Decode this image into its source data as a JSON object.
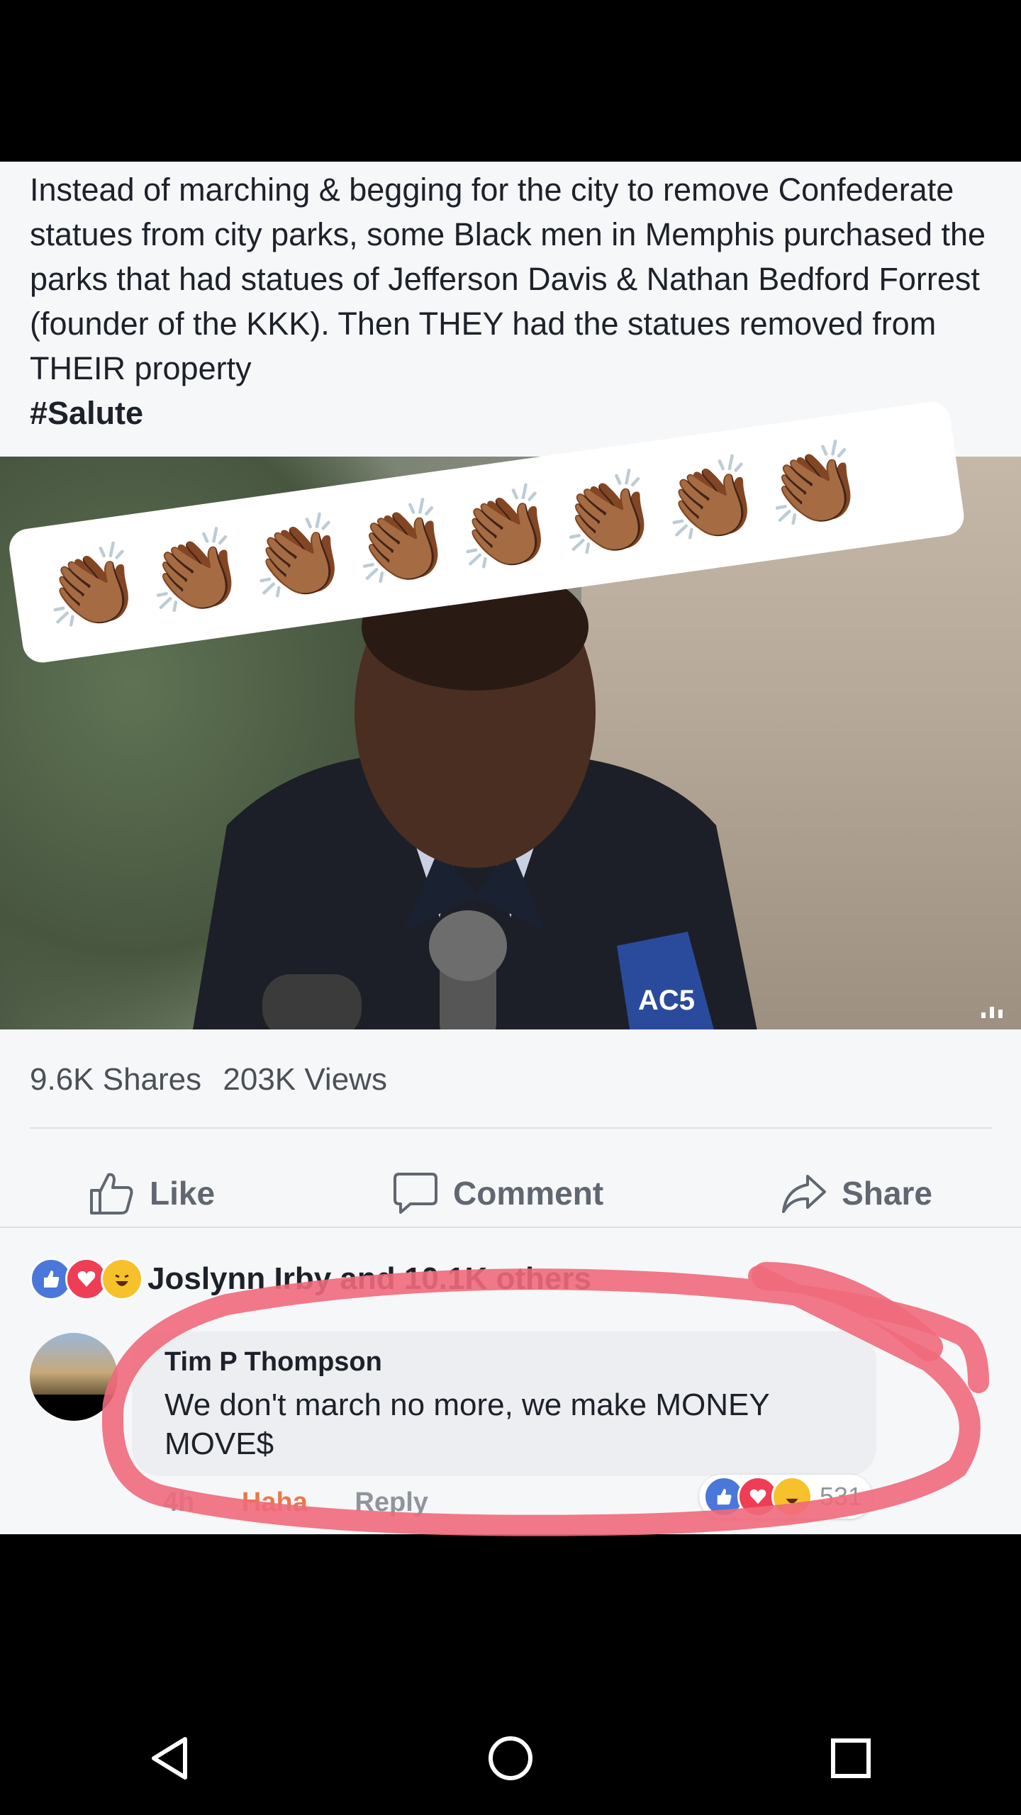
{
  "post": {
    "text": "Instead of marching & begging for the city to remove Confederate statues from city parks, some Black men in Memphis purchased the parks that had statues of Jefferson Davis & Nathan Bedford Forrest (founder of the KKK). Then THEY had the statues removed from THEIR property",
    "hashtag": "#Salute",
    "video": {
      "overlay_emoji": "👏🏾👏🏾👏🏾👏🏾👏🏾👏🏾👏🏾👏🏾",
      "mic_logo_text": "AC5"
    }
  },
  "stats": {
    "shares": "9.6K Shares",
    "views": "203K Views"
  },
  "actions": {
    "like": "Like",
    "comment": "Comment",
    "share": "Share"
  },
  "reactions": {
    "summary": "Joslynn Irby and 10.1K others"
  },
  "comment": {
    "author": "Tim P Thompson",
    "text": "We don't march no more, we make MONEY MOVE$",
    "time": "4h",
    "haha": "Haha",
    "reply": "Reply",
    "reaction_count": "531"
  },
  "colors": {
    "like_blue": "#4a77d9",
    "love_red": "#ee3d54",
    "haha_yellow": "#f7c12b",
    "ink_pink": "#f0697b"
  },
  "icons": [
    "thumbs-up-icon",
    "comment-icon",
    "share-arrow-icon",
    "like-reaction-icon",
    "love-reaction-icon",
    "haha-reaction-icon",
    "back-nav-icon",
    "home-nav-icon",
    "recents-nav-icon"
  ]
}
